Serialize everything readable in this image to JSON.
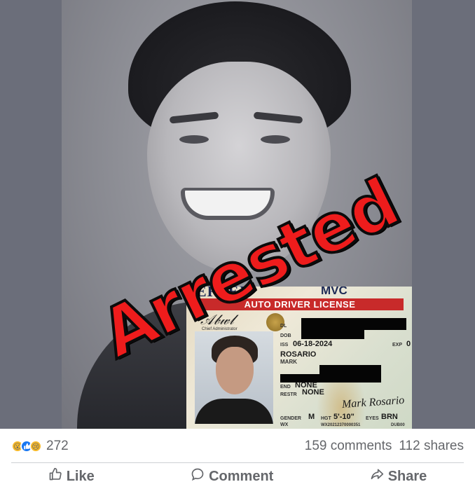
{
  "post_image": {
    "stamp_text": "Arrested",
    "license": {
      "state_header": "ERSEY",
      "agency": "MVC",
      "band_title": "AUTO DRIVER LICENSE",
      "admin_caption": "Chief Administrator",
      "fields": {
        "dl_label": "DL",
        "dob_label": "DOB",
        "iss_label": "ISS",
        "iss_value": "06-18-2024",
        "exp_label": "EXP",
        "exp_value": "0",
        "last_name": "ROSARIO",
        "first_name": "MARK",
        "end_label": "END",
        "end_value": "NONE",
        "restr_label": "RESTR",
        "restr_value": "NONE",
        "gender_label": "GENDER",
        "gender_value": "M",
        "hgt_label": "HGT",
        "hgt_value": "5'-10\"",
        "eyes_label": "EYES",
        "eyes_value": "BRN",
        "class_value": "WX",
        "doc_number": "WX20212370000351",
        "doc_suffix": "DUB00"
      },
      "holder_signature": "Mark Rosario"
    }
  },
  "reactions": {
    "icons": [
      "wow-icon",
      "like-icon",
      "sad-icon"
    ],
    "count": "272"
  },
  "stats": {
    "comments": "159 comments",
    "shares": "112 shares"
  },
  "actions": {
    "like": "Like",
    "comment": "Comment",
    "share": "Share"
  },
  "colors": {
    "stamp_red": "#ee1c1c",
    "like_blue": "#1877f2",
    "text_gray": "#65676b"
  }
}
